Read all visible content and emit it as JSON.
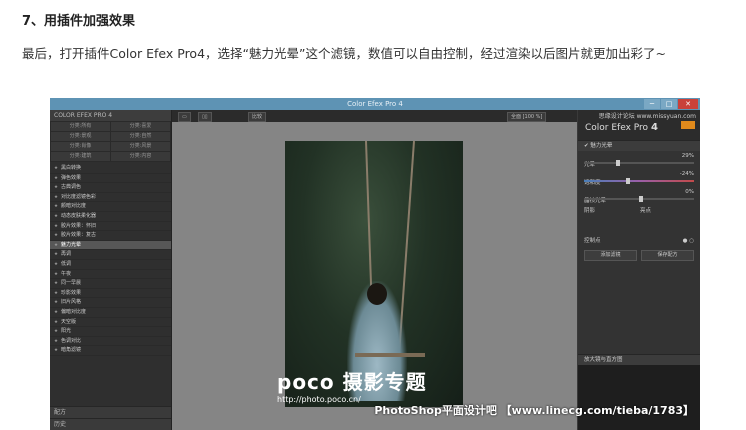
{
  "article": {
    "heading": "7、用插件加强效果",
    "paragraph": "最后，打开插件Color Efex Pro4，选择“魅力光晕”这个滤镜，数值可以自由控制，经过渲染以后图片就更加出彩了~"
  },
  "screenshot": {
    "window_title": "Color Efex Pro 4",
    "window_buttons": [
      "─",
      "□",
      "✕"
    ],
    "left_panel": {
      "header": "COLOR EFEX PRO 4",
      "categories": [
        "分类:所有",
        "分类:喜爱",
        "分类:景观",
        "分类:自然",
        "分类:肖像",
        "分类:风景",
        "分类:建筑",
        "分类:内容"
      ],
      "filters": [
        "黑白转换",
        "弹色效果",
        "古典调色",
        "对比度滤镜色彩",
        "颜暗对比度",
        "动态皮肤柔化器",
        "胶片效果：怀旧",
        "胶片效果：复古",
        "魅力光晕",
        "再调",
        "低调",
        "午夜",
        "同一早晨",
        "珍影效果",
        "旧片风格",
        "偏暗对比度",
        "天空版",
        "阳光",
        "色调对比",
        "暗角滤镜"
      ],
      "selected_filter": "魅力光晕",
      "bottom_items": [
        "配方",
        "历史"
      ]
    },
    "toolbar": {
      "compare_label": "比较",
      "zoom_label": "全面 [100 %]"
    },
    "right_panel": {
      "logo_text": "Color Efex Pro",
      "logo_number": "4",
      "site_text": "思缘设计论坛  www.missyuan.com",
      "filter_section": "✔ 魅力光晕",
      "sliders": [
        {
          "label": "光晕",
          "value": "29%",
          "position": 0.29,
          "gradient": false
        },
        {
          "label": "饱和度",
          "value": "-24%",
          "position": 0.38,
          "gradient": true
        },
        {
          "label": "晶核光晕",
          "value": "0%",
          "position": 0.5,
          "gradient": false
        }
      ],
      "tone_labels": [
        "阴影",
        "亮点"
      ],
      "control_points_label": "控制点",
      "buttons": [
        "添加滤镜",
        "保存配方"
      ],
      "loupe_label": "放大镜与直方图"
    },
    "watermark": {
      "brand": "poco 摄影专题",
      "url": "http://photo.poco.cn/"
    },
    "footer_watermark": "PhotoShop平面设计吧 【www.linecg.com/tieba/1783】"
  }
}
